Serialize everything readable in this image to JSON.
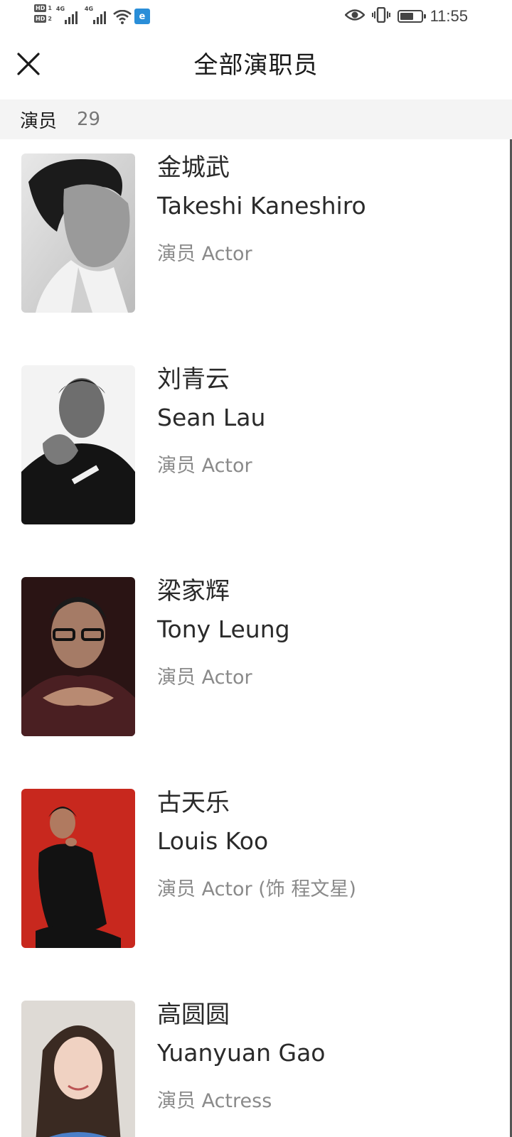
{
  "status_bar": {
    "sim1": "HD",
    "sim1_num": "1",
    "sim2": "HD",
    "sim2_num": "2",
    "network1": "4G",
    "network2": "4G",
    "app_badge": "e",
    "time": "11:55",
    "battery_level": 0.65,
    "icons": [
      "signal-icon",
      "signal-icon",
      "wifi-icon",
      "app-badge-icon",
      "eye-icon",
      "vibrate-icon",
      "battery-icon"
    ]
  },
  "header": {
    "title": "全部演职员",
    "close_icon": "close-icon"
  },
  "section": {
    "label": "演员",
    "count": "29"
  },
  "cast": [
    {
      "name_cn": "金城武",
      "name_en": "Takeshi Kaneshiro",
      "role": "演员 Actor",
      "photo_tone": "#8a8a8a"
    },
    {
      "name_cn": "刘青云",
      "name_en": "Sean Lau",
      "role": "演员 Actor",
      "photo_tone": "#1a1a1a"
    },
    {
      "name_cn": "梁家辉",
      "name_en": "Tony Leung",
      "role": "演员 Actor",
      "photo_tone": "#3a1f1f"
    },
    {
      "name_cn": "古天乐",
      "name_en": "Louis Koo",
      "role": "演员 Actor (饰 程文星)",
      "photo_tone": "#c8281e"
    },
    {
      "name_cn": "高圆圆",
      "name_en": "Yuanyuan Gao",
      "role": "演员 Actress",
      "photo_tone": "#d8d4cf"
    }
  ]
}
